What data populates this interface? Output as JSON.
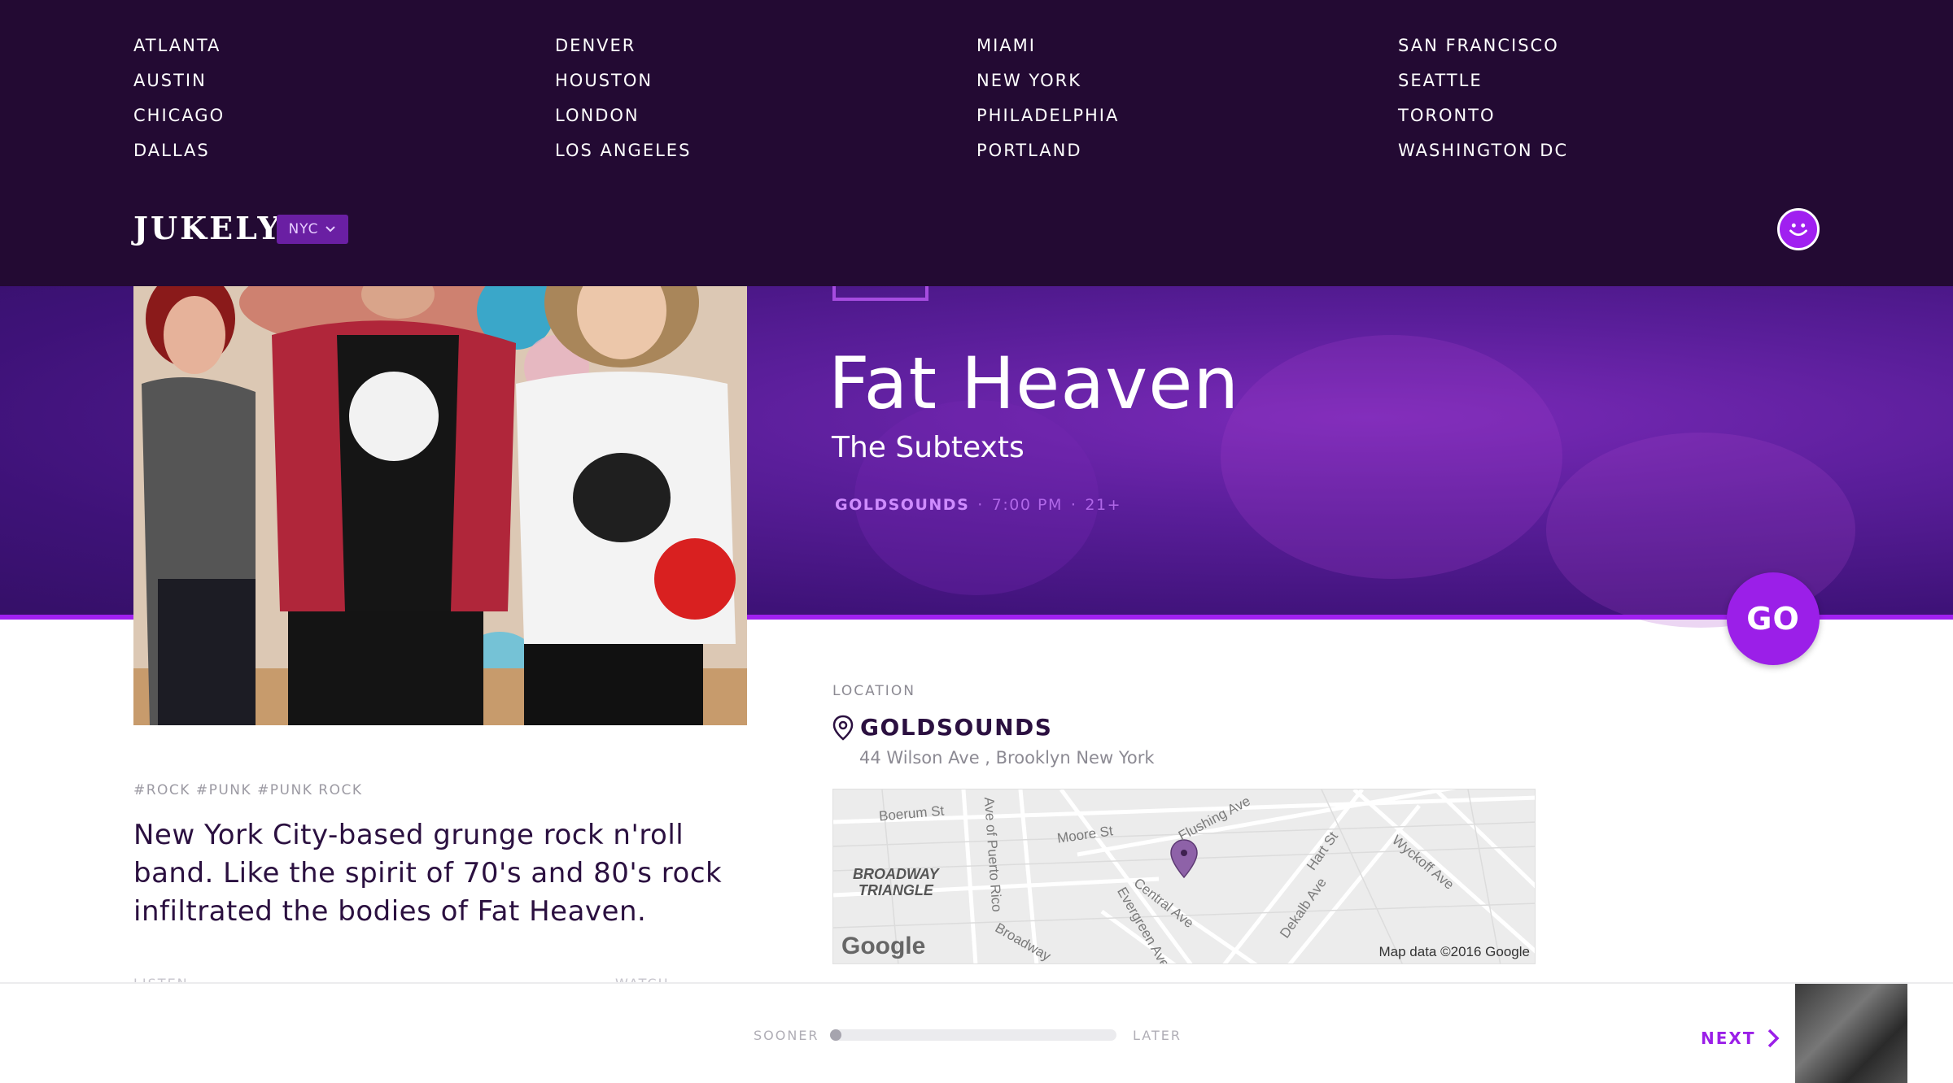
{
  "cities": {
    "col1": [
      "ATLANTA",
      "AUSTIN",
      "CHICAGO",
      "DALLAS"
    ],
    "col2": [
      "DENVER",
      "HOUSTON",
      "LONDON",
      "LOS ANGELES"
    ],
    "col3": [
      "MIAMI",
      "NEW YORK",
      "PHILADELPHIA",
      "PORTLAND"
    ],
    "col4": [
      "SAN FRANCISCO",
      "SEATTLE",
      "TORONTO",
      "WASHINGTON DC"
    ]
  },
  "header": {
    "logo": "JUKELY",
    "city_selector": "NYC"
  },
  "event": {
    "title": "Fat Heaven",
    "subtitle": "The Subtexts",
    "venue": "GOLDSOUNDS",
    "time": "7:00 PM",
    "age": "21+",
    "go_label": "GO",
    "tags": "#ROCK #PUNK #PUNK ROCK",
    "description": "New York City-based grunge rock n'roll band. Like the spirit of 70's and 80's rock infiltrated the bodies of Fat Heaven."
  },
  "location": {
    "label": "LOCATION",
    "venue": "GOLDSOUNDS",
    "address": "44 Wilson Ave , Brooklyn New York"
  },
  "map": {
    "streets": [
      "Boerum St",
      "Moore St",
      "Flushing Ave",
      "Hart St",
      "Wyckoff Ave",
      "Central Ave",
      "Evergreen Ave",
      "Dekalb Ave",
      "Broadway",
      "Ave of Puerto Rico"
    ],
    "area_label_line1": "BROADWAY",
    "area_label_line2": "TRIANGLE",
    "provider": "Google",
    "credit": "Map data ©2016 Google"
  },
  "lower_faded": {
    "left": "LISTEN",
    "right": "WATCH"
  },
  "footer": {
    "sooner": "SOONER",
    "later": "LATER",
    "slider_position": 0,
    "next": "NEXT"
  },
  "colors": {
    "header_bg": "#230a33",
    "accent": "#9b1fe8",
    "text_dark": "#2b1040"
  }
}
